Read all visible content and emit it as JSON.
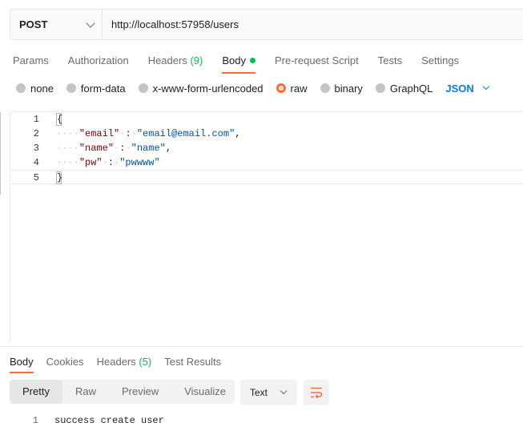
{
  "request": {
    "method": "POST",
    "url": "http://localhost:57958/users"
  },
  "request_tabs": [
    {
      "label": "Params"
    },
    {
      "label": "Authorization"
    },
    {
      "label": "Headers",
      "count": "(9)"
    },
    {
      "label": "Body",
      "active": true
    },
    {
      "label": "Pre-request Script"
    },
    {
      "label": "Tests"
    },
    {
      "label": "Settings"
    }
  ],
  "body_types": [
    {
      "label": "none",
      "checked": false
    },
    {
      "label": "form-data",
      "checked": false
    },
    {
      "label": "x-www-form-urlencoded",
      "checked": false
    },
    {
      "label": "raw",
      "checked": true
    },
    {
      "label": "binary",
      "checked": false
    },
    {
      "label": "GraphQL",
      "checked": false
    }
  ],
  "language": "JSON",
  "editor": {
    "lines": [
      {
        "n": "1",
        "open": "{"
      },
      {
        "n": "2",
        "key": "\"email\"",
        "value": "\"email@email.com\"",
        "trail": ","
      },
      {
        "n": "3",
        "key": "\"name\"",
        "value": "\"name\"",
        "trail": ","
      },
      {
        "n": "4",
        "key": "\"pw\"",
        "value": "\"pwwww\"",
        "trail": ""
      },
      {
        "n": "5",
        "close": "}"
      }
    ]
  },
  "response_tabs": [
    {
      "label": "Body",
      "active": true
    },
    {
      "label": "Cookies"
    },
    {
      "label": "Headers",
      "count": "(5)"
    },
    {
      "label": "Test Results"
    }
  ],
  "response_views": [
    {
      "label": "Pretty",
      "active": true
    },
    {
      "label": "Raw"
    },
    {
      "label": "Preview"
    },
    {
      "label": "Visualize"
    }
  ],
  "response_format": "Text",
  "wrap_icon": "wrap-lines-icon",
  "response_body": [
    {
      "n": "1",
      "text": "success create user"
    }
  ],
  "colors": {
    "accent": "#ff6c37",
    "success": "#0cbb52",
    "link": "#097bed",
    "json_key": "#800000",
    "json_string": "#0451a5"
  }
}
